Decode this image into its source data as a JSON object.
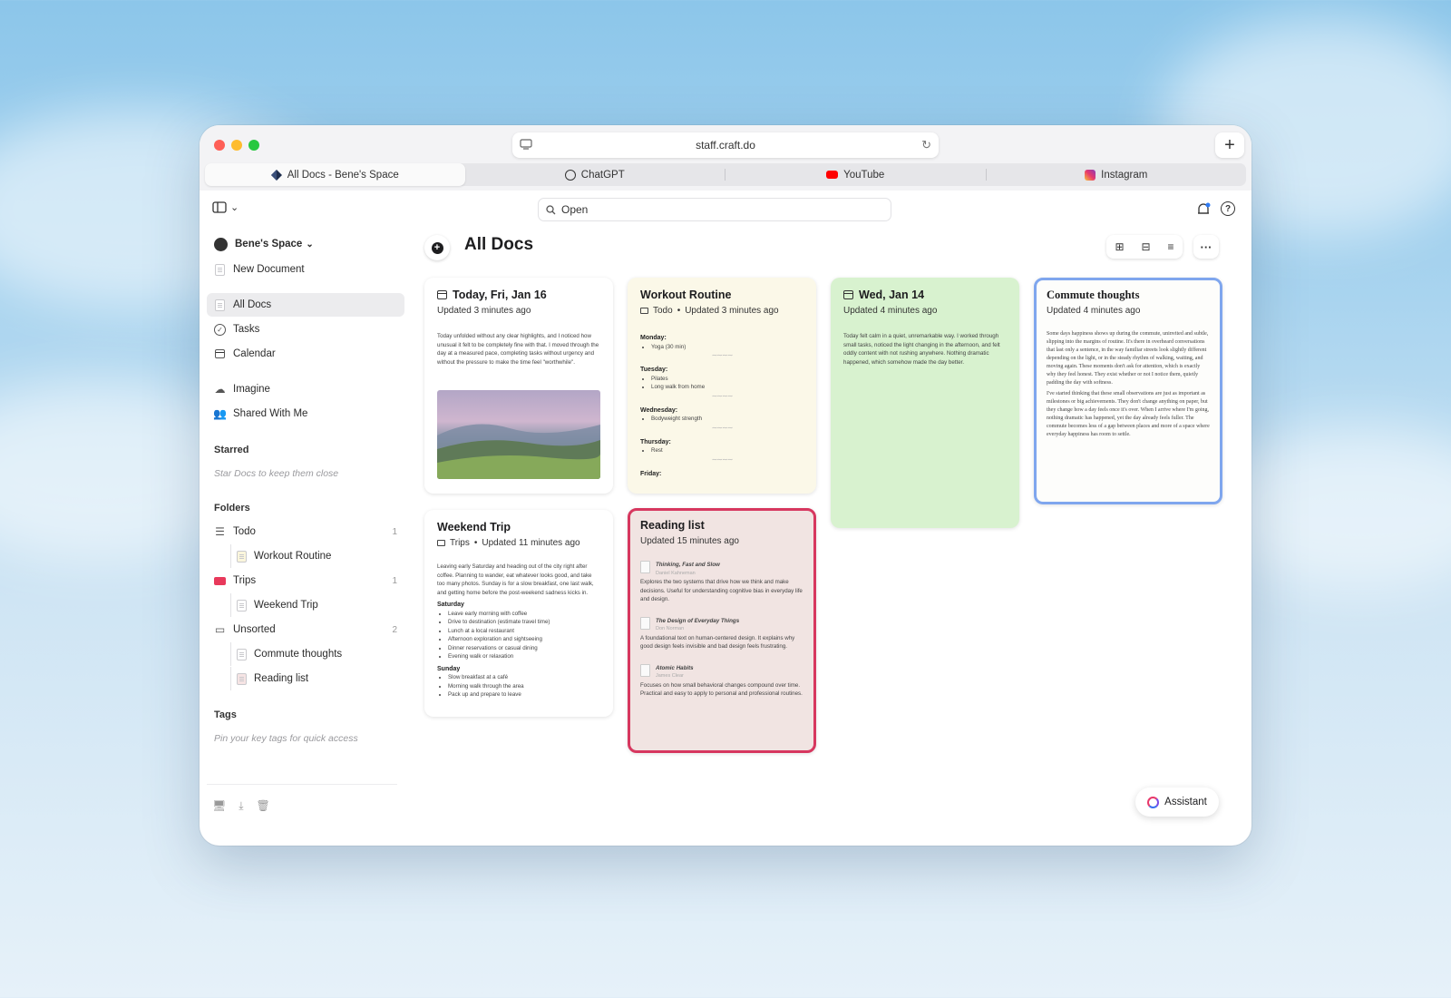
{
  "browser": {
    "url": "staff.craft.do",
    "tabs": [
      {
        "label": "All Docs - Bene's Space",
        "active": true,
        "icon": "craft-logo-icon"
      },
      {
        "label": "ChatGPT",
        "active": false,
        "icon": "chatgpt-logo-icon"
      },
      {
        "label": "YouTube",
        "active": false,
        "icon": "youtube-logo-icon"
      },
      {
        "label": "Instagram",
        "active": false,
        "icon": "instagram-logo-icon"
      }
    ]
  },
  "toolbar": {
    "search_placeholder": "Open"
  },
  "sidebar": {
    "space_name": "Bene's Space",
    "new_document": "New Document",
    "nav": [
      {
        "label": "All Docs",
        "icon": "doc-stack-icon",
        "active": true
      },
      {
        "label": "Tasks",
        "icon": "check-circle-icon"
      },
      {
        "label": "Calendar",
        "icon": "calendar-icon"
      },
      {
        "label": "Imagine",
        "icon": "cloud-icon"
      },
      {
        "label": "Shared With Me",
        "icon": "shared-users-icon"
      }
    ],
    "starred_heading": "Starred",
    "starred_hint": "Star Docs to keep them close",
    "folders_heading": "Folders",
    "folders": [
      {
        "label": "Todo",
        "count": "1",
        "children": [
          "Workout Routine"
        ]
      },
      {
        "label": "Trips",
        "count": "1",
        "children": [
          "Weekend Trip"
        ]
      },
      {
        "label": "Unsorted",
        "count": "2",
        "children": [
          "Commute thoughts",
          "Reading list"
        ]
      }
    ],
    "tags_heading": "Tags",
    "tags_hint": "Pin your key tags for quick access"
  },
  "main": {
    "title": "All Docs",
    "assistant_label": "Assistant",
    "cards": {
      "today": {
        "title": "Today, Fri, Jan 16",
        "updated": "Updated 3 minutes ago",
        "body": "Today unfolded without any clear highlights, and I noticed how unusual it felt to be completely fine with that. I moved through the day at a measured pace, completing tasks without urgency and without the pressure to make the time feel \"worthwhile\"."
      },
      "workout": {
        "title": "Workout Routine",
        "folder": "Todo",
        "updated": "Updated 3 minutes ago",
        "days": [
          {
            "day": "Monday:",
            "items": [
              "Yoga (30 min)"
            ]
          },
          {
            "day": "Tuesday:",
            "items": [
              "Pilates",
              "Long walk from home"
            ]
          },
          {
            "day": "Wednesday:",
            "items": [
              "Bodyweight strength"
            ]
          },
          {
            "day": "Thursday:",
            "items": [
              "Rest"
            ]
          },
          {
            "day": "Friday:",
            "items": []
          }
        ]
      },
      "wed": {
        "title": "Wed, Jan 14",
        "updated": "Updated 4 minutes ago",
        "body": "Today felt calm in a quiet, unremarkable way. I worked through small tasks, noticed the light changing in the afternoon, and felt oddly content with not rushing anywhere. Nothing dramatic happened, which somehow made the day better."
      },
      "commute": {
        "title": "Commute thoughts",
        "updated": "Updated 4 minutes ago",
        "body1": "Some days happiness shows up during the commute, uninvited and subtle, slipping into the margins of routine. It's there in overheard conversations that last only a sentence, in the way familiar streets look slightly different depending on the light, or in the steady rhythm of walking, waiting, and moving again. These moments don't ask for attention, which is exactly why they feel honest. They exist whether or not I notice them, quietly padding the day with softness.",
        "body2": "I've started thinking that these small observations are just as important as milestones or big achievements. They don't change anything on paper, but they change how a day feels once it's over. When I arrive where I'm going, nothing dramatic has happened, yet the day already feels fuller. The commute becomes less of a gap between places and more of a space where everyday happiness has room to settle."
      },
      "weekend": {
        "title": "Weekend Trip",
        "folder": "Trips",
        "updated": "Updated 11 minutes ago",
        "body": "Leaving early Saturday and heading out of the city right after coffee. Planning to wander, eat whatever looks good, and take too many photos. Sunday is for a slow breakfast, one last walk, and getting home before the post-weekend sadness kicks in.",
        "saturday_heading": "Saturday",
        "saturday": [
          "Leave early morning with coffee",
          "Drive to destination (estimate travel time)",
          "Lunch at a local restaurant",
          "Afternoon exploration and sightseeing",
          "Dinner reservations or casual dining",
          "Evening walk or relaxation"
        ],
        "sunday_heading": "Sunday",
        "sunday": [
          "Slow breakfast at a café",
          "Morning walk through the area",
          "Pack up and prepare to leave"
        ]
      },
      "reading": {
        "title": "Reading list",
        "updated": "Updated 15 minutes ago",
        "books": [
          {
            "title": "Thinking, Fast and Slow",
            "author": "Daniel Kahneman",
            "desc": "Explores the two systems that drive how we think and make decisions. Useful for understanding cognitive bias in everyday life and design."
          },
          {
            "title": "The Design of Everyday Things",
            "author": "Don Norman",
            "desc": "A foundational text on human-centered design. It explains why good design feels invisible and bad design feels frustrating."
          },
          {
            "title": "Atomic Habits",
            "author": "James Clear",
            "desc": "Focuses on how small behavioral changes compound over time. Practical and easy to apply to personal and professional routines."
          }
        ]
      }
    }
  },
  "colors": {
    "workout_bg": "#fbf8e8",
    "wed_bg": "#d8f2cf",
    "reading_bg": "#f1e4e2",
    "reading_border": "#d7375f",
    "commute_border": "#7fa6ee"
  }
}
